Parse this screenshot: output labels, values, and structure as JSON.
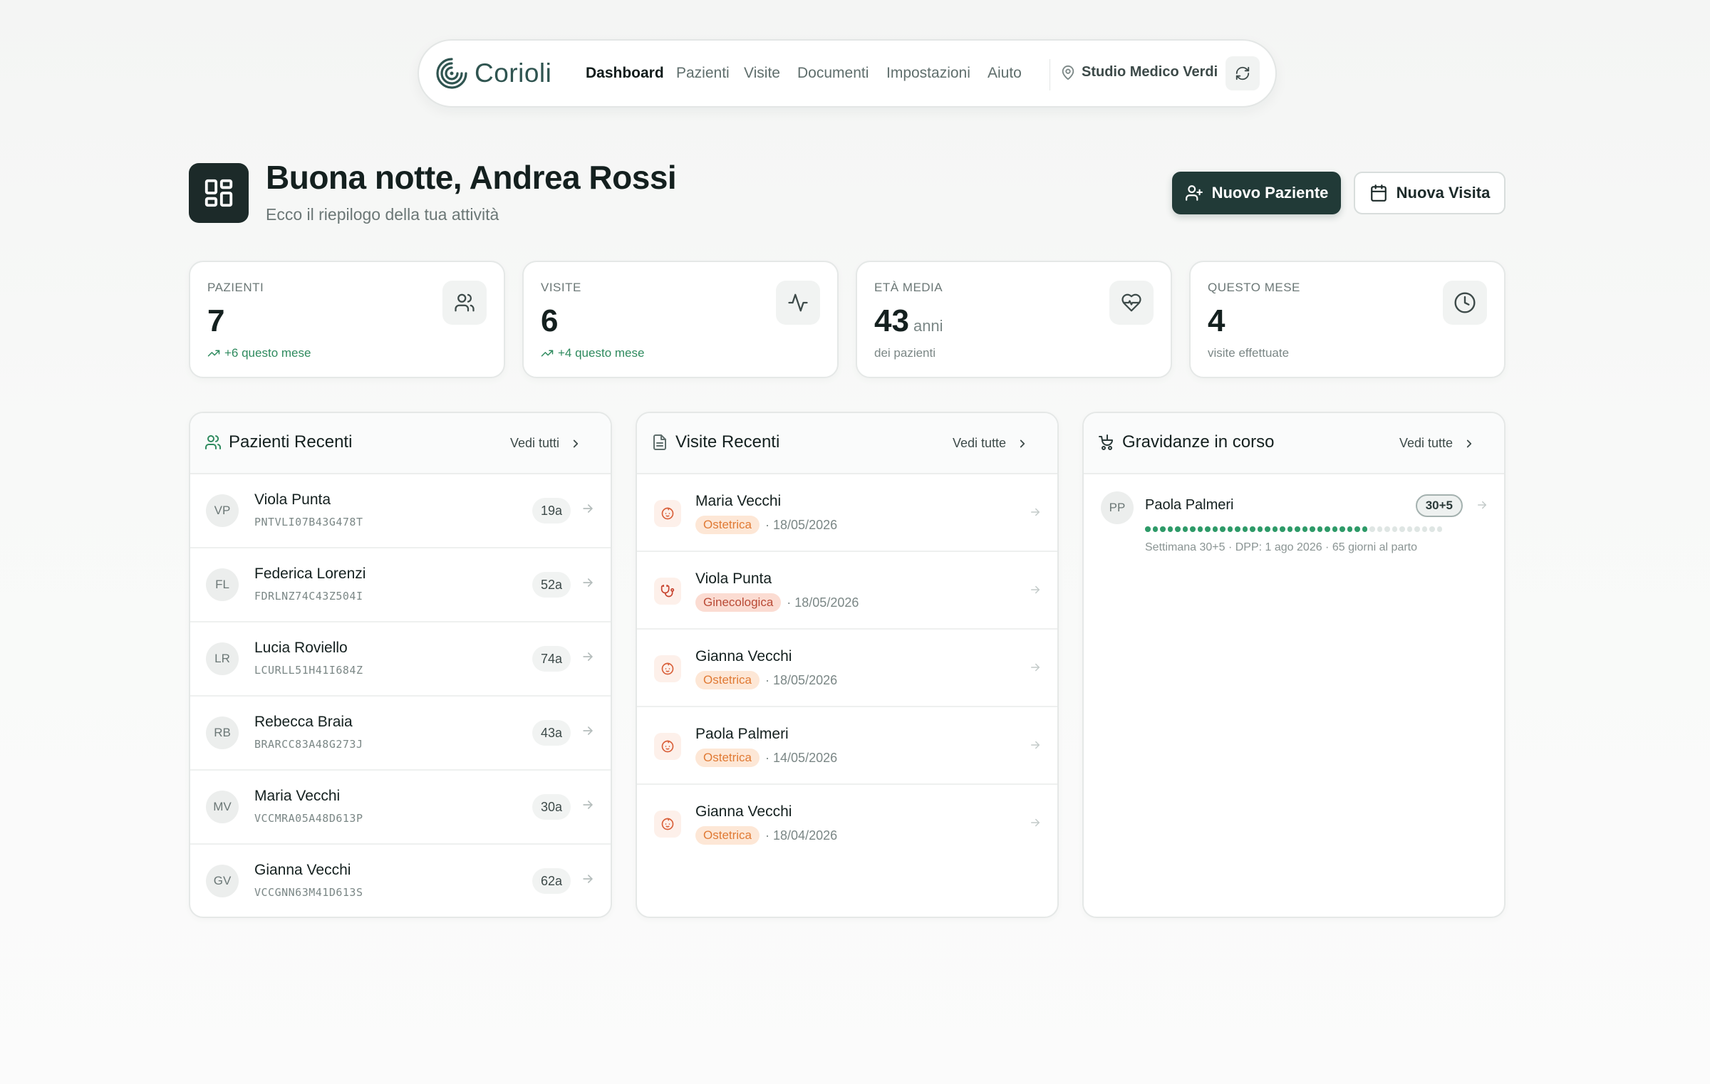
{
  "nav": {
    "brand": "Corioli",
    "items": [
      "Dashboard",
      "Pazienti",
      "Visite",
      "Documenti",
      "Impostazioni",
      "Aiuto"
    ],
    "active": "Dashboard",
    "clinic": "Studio Medico Verdi"
  },
  "header": {
    "greeting": "Buona notte, Andrea Rossi",
    "subtitle": "Ecco il riepilogo della tua attività",
    "new_patient_label": "Nuovo Paziente",
    "new_visit_label": "Nuova Visita"
  },
  "stats": [
    {
      "label": "PAZIENTI",
      "value": "7",
      "unit": "",
      "foot": "+6 questo mese",
      "trend": true,
      "icon": "users-icon"
    },
    {
      "label": "VISITE",
      "value": "6",
      "unit": "",
      "foot": "+4 questo mese",
      "trend": true,
      "icon": "activity-icon"
    },
    {
      "label": "ETÀ MEDIA",
      "value": "43",
      "unit": "anni",
      "foot": "dei pazienti",
      "trend": false,
      "icon": "heart-pulse-icon"
    },
    {
      "label": "QUESTO MESE",
      "value": "4",
      "unit": "",
      "foot": "visite effettuate",
      "trend": false,
      "icon": "clock-icon"
    }
  ],
  "recent_patients": {
    "title": "Pazienti Recenti",
    "link": "Vedi tutti",
    "items": [
      {
        "initials": "VP",
        "name": "Viola Punta",
        "code": "PNTVLI07B43G478T",
        "age": "19a"
      },
      {
        "initials": "FL",
        "name": "Federica Lorenzi",
        "code": "FDRLNZ74C43Z504I",
        "age": "52a"
      },
      {
        "initials": "LR",
        "name": "Lucia Roviello",
        "code": "LCURLL51H41I684Z",
        "age": "74a"
      },
      {
        "initials": "RB",
        "name": "Rebecca Braia",
        "code": "BRARCC83A48G273J",
        "age": "43a"
      },
      {
        "initials": "MV",
        "name": "Maria Vecchi",
        "code": "VCCMRA05A48D613P",
        "age": "30a"
      },
      {
        "initials": "GV",
        "name": "Gianna Vecchi",
        "code": "VCCGNN63M41D613S",
        "age": "62a"
      }
    ]
  },
  "recent_visits": {
    "title": "Visite Recenti",
    "link": "Vedi tutte",
    "items": [
      {
        "name": "Maria Vecchi",
        "type": "Ostetrica",
        "kind": "ost",
        "date": "· 18/05/2026"
      },
      {
        "name": "Viola Punta",
        "type": "Ginecologica",
        "kind": "gin",
        "date": "· 18/05/2026"
      },
      {
        "name": "Gianna Vecchi",
        "type": "Ostetrica",
        "kind": "ost",
        "date": "· 18/05/2026"
      },
      {
        "name": "Paola Palmeri",
        "type": "Ostetrica",
        "kind": "ost",
        "date": "· 14/05/2026"
      },
      {
        "name": "Gianna Vecchi",
        "type": "Ostetrica",
        "kind": "ost",
        "date": "· 18/04/2026"
      }
    ]
  },
  "pregnancies": {
    "title": "Gravidanze in corso",
    "link": "Vedi tutte",
    "items": [
      {
        "initials": "PP",
        "name": "Paola Palmeri",
        "badge": "30+5",
        "progress_weeks": 30,
        "total_weeks": 40,
        "info": "Settimana 30+5 · DPP: 1 ago 2026 · 65 giorni al parto"
      }
    ]
  },
  "colors": {
    "primary": "#213a37",
    "accent_green": "#2e9a68",
    "ostetrica": "#e07a34",
    "ginecologica": "#b94a35"
  }
}
